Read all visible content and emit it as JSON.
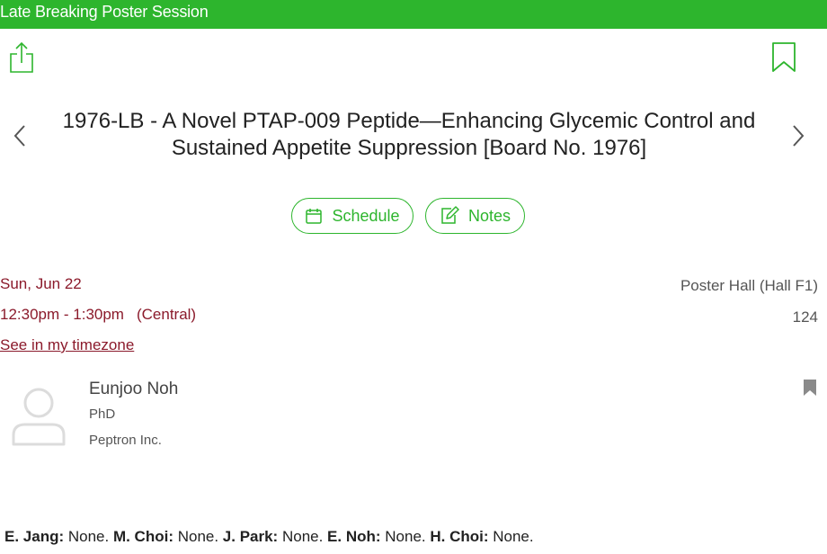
{
  "session_type": "Late Breaking Poster Session",
  "title": "1976-LB - A Novel PTAP-009 Peptide—Enhancing Glycemic Control and Sustained Appetite Suppression [Board No. 1976]",
  "buttons": {
    "schedule": "Schedule",
    "notes": "Notes"
  },
  "icons": {
    "share": "share-icon",
    "bookmark": "bookmark-icon",
    "prev": "chevron-left-icon",
    "next": "chevron-right-icon",
    "calendar": "calendar-icon",
    "edit": "edit-icon",
    "avatar": "user-avatar-icon",
    "speaker_bookmark": "bookmark-filled-icon"
  },
  "colors": {
    "accent": "#2db52d",
    "date_text": "#8b1a2b"
  },
  "when": {
    "date": "Sun, Jun 22",
    "time": "12:30pm - 1:30pm",
    "timezone": "(Central)",
    "timezone_link": "See in my timezone"
  },
  "where": {
    "location": "Poster Hall (Hall F1)",
    "room": "124"
  },
  "speaker": {
    "name": "Eunjoo Noh",
    "degree": "PhD",
    "organization": "Peptron Inc."
  },
  "disclosures": [
    {
      "name": "E. Jang:",
      "text": " None. "
    },
    {
      "name": "M. Choi:",
      "text": " None. "
    },
    {
      "name": "J. Park:",
      "text": " None. "
    },
    {
      "name": "E. Noh:",
      "text": " None. "
    },
    {
      "name": "H. Choi:",
      "text": " None."
    }
  ]
}
